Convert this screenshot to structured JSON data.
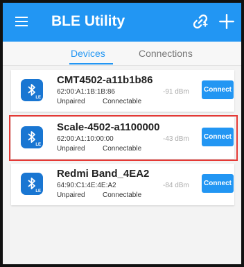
{
  "app": {
    "title": "BLE Utility"
  },
  "tabs": [
    {
      "label": "Devices",
      "selected": true
    },
    {
      "label": "Connections",
      "selected": false
    }
  ],
  "devices": [
    {
      "name": "CMT4502-a11b1b86",
      "mac": "62:00:A1:1B:1B:86",
      "bond": "Unpaired",
      "type": "Connectable",
      "rssi": "-91 dBm",
      "action": "Connect",
      "highlighted": false
    },
    {
      "name": "Scale-4502-a1100000",
      "mac": "62:00:A1:10:00:00",
      "bond": "Unpaired",
      "type": "Connectable",
      "rssi": "-43 dBm",
      "action": "Connect",
      "highlighted": true
    },
    {
      "name": "Redmi Band_4EA2",
      "mac": "64:90:C1:4E:4E:A2",
      "bond": "Unpaired",
      "type": "Connectable",
      "rssi": "-84 dBm",
      "action": "Connect",
      "highlighted": false
    }
  ],
  "icons": {
    "menu": "menu-icon",
    "link": "link-icon",
    "add": "add-icon",
    "device": "bluetooth-le-icon",
    "le_badge": "LE"
  },
  "colors": {
    "primary": "#2296f3",
    "device_icon": "#1976d2",
    "highlight": "#e53935",
    "background": "#f3f3f3"
  }
}
